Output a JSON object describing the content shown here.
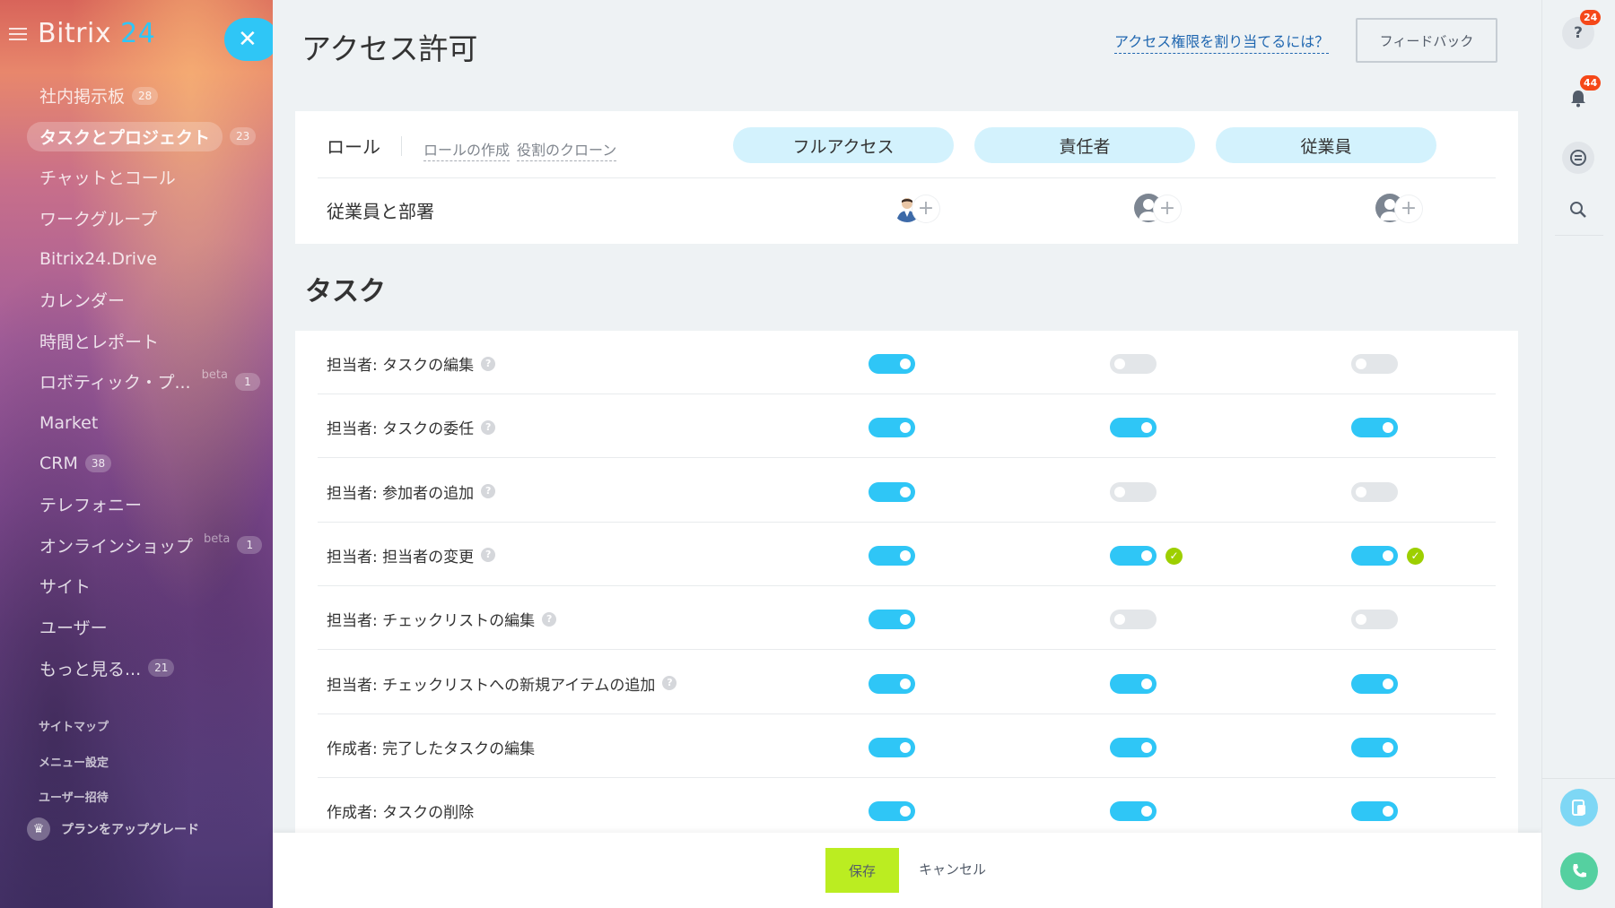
{
  "sidebar": {
    "logo_brand": "Bitrix",
    "logo_num": "24",
    "close_glyph": "✕",
    "items": [
      {
        "label": "社内掲示板",
        "count": "28"
      },
      {
        "label": "タスクとプロジェクト",
        "count": "23"
      },
      {
        "label": "チャットとコール"
      },
      {
        "label": "ワークグループ"
      },
      {
        "label": "Bitrix24.Drive"
      },
      {
        "label": "カレンダー"
      },
      {
        "label": "時間とレポート"
      },
      {
        "label": "ロボティック・プ...",
        "beta": "beta",
        "count": "1"
      },
      {
        "label": "Market"
      },
      {
        "label": "CRM",
        "count": "38"
      },
      {
        "label": "テレフォニー"
      },
      {
        "label": "オンラインショップ",
        "beta": "beta",
        "count": "1"
      },
      {
        "label": "サイト"
      },
      {
        "label": "ユーザー"
      },
      {
        "label": "もっと見る...",
        "count": "21"
      }
    ],
    "sub_items": [
      "サイトマップ",
      "メニュー設定",
      "ユーザー招待"
    ],
    "upgrade_label": "プランをアップグレード"
  },
  "header": {
    "title": "アクセス許可",
    "help_link": "アクセス権限を割り当てるには？",
    "feedback": "フィードバック"
  },
  "roles": {
    "label": "ロール",
    "create": "ロールの作成",
    "clone": "役割のクローン",
    "columns": [
      "フルアクセス",
      "責任者",
      "従業員"
    ],
    "employees_label": "従業員と部署",
    "plus_glyph": "+"
  },
  "section": {
    "title": "タスク"
  },
  "permissions": [
    {
      "label": "担当者: タスクの編集",
      "help": true,
      "values": [
        true,
        false,
        false
      ],
      "checks": [
        false,
        false,
        false
      ]
    },
    {
      "label": "担当者: タスクの委任",
      "help": true,
      "values": [
        true,
        true,
        true
      ],
      "checks": [
        false,
        false,
        false
      ]
    },
    {
      "label": "担当者: 参加者の追加",
      "help": true,
      "values": [
        true,
        false,
        false
      ],
      "checks": [
        false,
        false,
        false
      ]
    },
    {
      "label": "担当者: 担当者の変更",
      "help": true,
      "values": [
        true,
        true,
        true
      ],
      "checks": [
        false,
        true,
        true
      ]
    },
    {
      "label": "担当者: チェックリストの編集",
      "help": true,
      "values": [
        true,
        false,
        false
      ],
      "checks": [
        false,
        false,
        false
      ]
    },
    {
      "label": "担当者: チェックリストへの新規アイテムの追加",
      "help": true,
      "values": [
        true,
        true,
        true
      ],
      "checks": [
        false,
        false,
        false
      ]
    },
    {
      "label": "作成者: 完了したタスクの編集",
      "help": false,
      "values": [
        true,
        true,
        true
      ],
      "checks": [
        false,
        false,
        false
      ]
    },
    {
      "label": "作成者: タスクの削除",
      "help": false,
      "values": [
        true,
        true,
        true
      ],
      "checks": [
        false,
        false,
        false
      ]
    }
  ],
  "help_glyph": "?",
  "check_glyph": "✓",
  "footer": {
    "save": "保存",
    "cancel": "キャンセル"
  },
  "right_panel": {
    "help_badge": "24",
    "notify_badge": "44",
    "help_glyph": "?"
  },
  "colors": {
    "accent": "#2fc6f6",
    "role_chip": "#d3f2fd",
    "save": "#bbed21",
    "check": "#9dcf00",
    "badge": "#f54819"
  }
}
